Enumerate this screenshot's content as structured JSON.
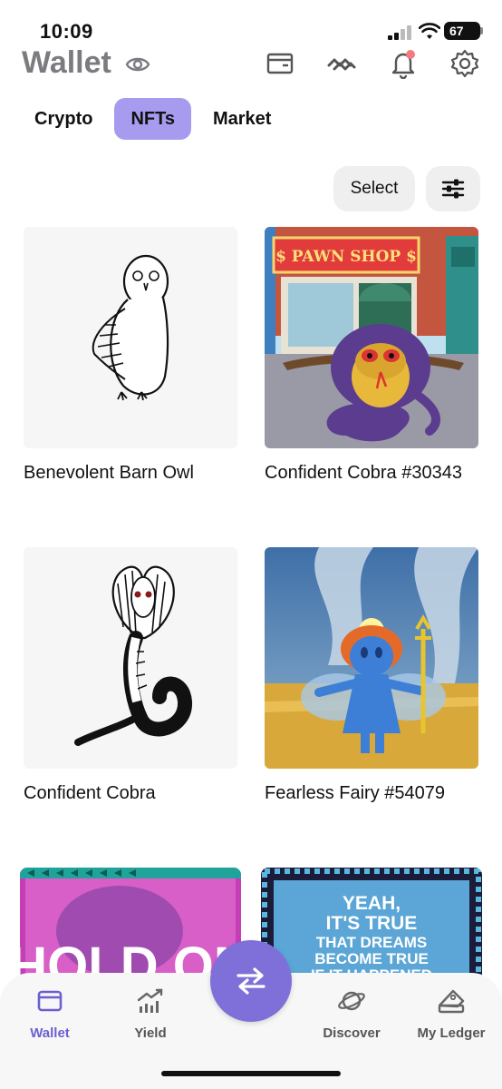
{
  "status_bar": {
    "time": "10:09",
    "battery": "67"
  },
  "header": {
    "title": "Wallet"
  },
  "tabs": [
    {
      "label": "Crypto",
      "active": false
    },
    {
      "label": "NFTs",
      "active": true
    },
    {
      "label": "Market",
      "active": false
    }
  ],
  "toolbar": {
    "select_label": "Select"
  },
  "nfts": [
    {
      "name": "Benevolent Barn Owl",
      "art": "owl-sketch"
    },
    {
      "name": "Confident Cobra #30343",
      "art": "cobra-pawn-shop"
    },
    {
      "name": "Confident Cobra",
      "art": "cobra-sketch"
    },
    {
      "name": "Fearless Fairy #54079",
      "art": "fairy-tornado"
    },
    {
      "name": "",
      "art": "hold-on-poster",
      "overlay_text": "HOLD ON"
    },
    {
      "name": "",
      "art": "dreams-poster",
      "overlay_text": [
        "YEAH,",
        "IT'S TRUE",
        "THAT DREAMS",
        "BECOME TRUE",
        "IF IT HAPPENED"
      ]
    }
  ],
  "bottom_nav": [
    {
      "label": "Wallet",
      "icon": "wallet-icon",
      "active": true
    },
    {
      "label": "Yield",
      "icon": "chart-growth-icon",
      "active": false
    },
    {
      "label": "Discover",
      "icon": "planet-icon",
      "active": false
    },
    {
      "label": "My Ledger",
      "icon": "ledger-device-icon",
      "active": false
    }
  ],
  "colors": {
    "accent": "#7e6fd9",
    "tab_active": "#a79bf0",
    "title_gray": "#7b7b80",
    "notification_dot": "#f27a80"
  }
}
